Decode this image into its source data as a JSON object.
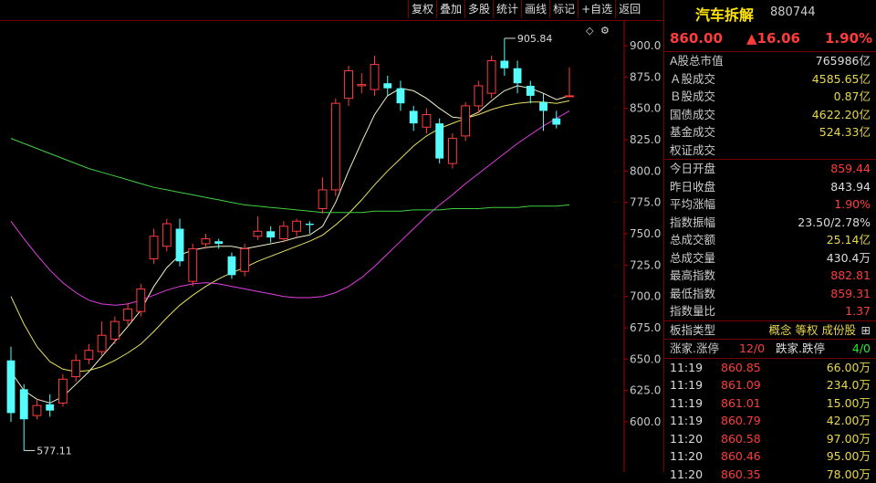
{
  "toolbar": {
    "items": [
      "复权",
      "叠加",
      "多股",
      "统计",
      "画线",
      "标记",
      "+自选",
      "返回"
    ]
  },
  "chart_icons": {
    "diamond": "◇",
    "settings": "⚙"
  },
  "chart_data": {
    "type": "candlestick",
    "yticks": [
      "900.0",
      "875.0",
      "850.0",
      "825.0",
      "800.0",
      "775.0",
      "750.0",
      "725.0",
      "700.0",
      "675.0",
      "650.0",
      "625.0",
      "600.0"
    ],
    "ylim": [
      580,
      915
    ],
    "annotations": {
      "high": "905.84",
      "low": "577.11"
    },
    "candles": [
      {
        "o": 649,
        "c": 607,
        "h": 660,
        "l": 600
      },
      {
        "o": 626,
        "c": 602,
        "h": 630,
        "l": 577
      },
      {
        "o": 605,
        "c": 613,
        "h": 618,
        "l": 602
      },
      {
        "o": 614,
        "c": 609,
        "h": 622,
        "l": 604
      },
      {
        "o": 615,
        "c": 634,
        "h": 638,
        "l": 612
      },
      {
        "o": 636,
        "c": 649,
        "h": 654,
        "l": 632
      },
      {
        "o": 650,
        "c": 657,
        "h": 662,
        "l": 646
      },
      {
        "o": 656,
        "c": 669,
        "h": 680,
        "l": 653
      },
      {
        "o": 666,
        "c": 680,
        "h": 684,
        "l": 662
      },
      {
        "o": 681,
        "c": 690,
        "h": 695,
        "l": 677
      },
      {
        "o": 688,
        "c": 706,
        "h": 710,
        "l": 684
      },
      {
        "o": 730,
        "c": 748,
        "h": 754,
        "l": 726
      },
      {
        "o": 740,
        "c": 758,
        "h": 762,
        "l": 736
      },
      {
        "o": 754,
        "c": 728,
        "h": 762,
        "l": 724
      },
      {
        "o": 712,
        "c": 738,
        "h": 742,
        "l": 708
      },
      {
        "o": 742,
        "c": 746,
        "h": 750,
        "l": 738
      },
      {
        "o": 744,
        "c": 742,
        "h": 746,
        "l": 738
      },
      {
        "o": 732,
        "c": 717,
        "h": 735,
        "l": 714
      },
      {
        "o": 720,
        "c": 738,
        "h": 742,
        "l": 716
      },
      {
        "o": 748,
        "c": 752,
        "h": 764,
        "l": 745
      },
      {
        "o": 752,
        "c": 747,
        "h": 756,
        "l": 743
      },
      {
        "o": 746,
        "c": 756,
        "h": 760,
        "l": 743
      },
      {
        "o": 752,
        "c": 760,
        "h": 762,
        "l": 748
      },
      {
        "o": 758,
        "c": 757,
        "h": 760,
        "l": 750
      },
      {
        "o": 770,
        "c": 785,
        "h": 795,
        "l": 766
      },
      {
        "o": 785,
        "c": 854,
        "h": 858,
        "l": 780
      },
      {
        "o": 858,
        "c": 880,
        "h": 884,
        "l": 852
      },
      {
        "o": 868,
        "c": 869,
        "h": 878,
        "l": 862
      },
      {
        "o": 865,
        "c": 885,
        "h": 892,
        "l": 860
      },
      {
        "o": 870,
        "c": 866,
        "h": 876,
        "l": 860
      },
      {
        "o": 866,
        "c": 854,
        "h": 872,
        "l": 848
      },
      {
        "o": 848,
        "c": 838,
        "h": 852,
        "l": 832
      },
      {
        "o": 835,
        "c": 845,
        "h": 850,
        "l": 830
      },
      {
        "o": 838,
        "c": 810,
        "h": 842,
        "l": 806
      },
      {
        "o": 806,
        "c": 826,
        "h": 830,
        "l": 802
      },
      {
        "o": 828,
        "c": 852,
        "h": 855,
        "l": 824
      },
      {
        "o": 852,
        "c": 868,
        "h": 872,
        "l": 846
      },
      {
        "o": 862,
        "c": 888,
        "h": 892,
        "l": 858
      },
      {
        "o": 888,
        "c": 882,
        "h": 905.84,
        "l": 876
      },
      {
        "o": 882,
        "c": 870,
        "h": 888,
        "l": 862
      },
      {
        "o": 868,
        "c": 860,
        "h": 872,
        "l": 854
      },
      {
        "o": 855,
        "c": 848,
        "h": 862,
        "l": 832
      },
      {
        "o": 842,
        "c": 837,
        "h": 848,
        "l": 834
      },
      {
        "o": 859.44,
        "c": 860,
        "h": 882.81,
        "l": 859.31
      }
    ],
    "ma_fast": [
      640,
      625,
      618,
      615,
      620,
      630,
      640,
      652,
      664,
      676,
      689,
      708,
      723,
      733,
      737,
      739,
      740,
      740,
      738,
      740,
      742,
      744,
      747,
      749,
      756,
      775,
      800,
      823,
      845,
      860,
      866,
      864,
      858,
      850,
      843,
      842,
      847,
      856,
      864,
      868,
      866,
      862,
      857,
      860
    ],
    "ma_mid": [
      700,
      678,
      660,
      648,
      642,
      640,
      641,
      644,
      649,
      655,
      662,
      672,
      683,
      693,
      701,
      708,
      714,
      719,
      723,
      728,
      732,
      736,
      740,
      744,
      749,
      757,
      766,
      777,
      789,
      800,
      810,
      820,
      828,
      834,
      838,
      842,
      845,
      849,
      852,
      854,
      855,
      855,
      854,
      856
    ],
    "ma_slow": [
      760,
      746,
      733,
      721,
      711,
      703,
      697,
      694,
      693,
      694,
      697,
      701,
      705,
      708,
      710,
      711,
      710,
      708,
      706,
      704,
      702,
      700,
      699,
      699,
      700,
      703,
      708,
      715,
      724,
      734,
      744,
      754,
      764,
      773,
      781,
      790,
      798,
      806,
      814,
      822,
      829,
      836,
      842,
      848
    ],
    "ma_long": [
      826,
      822,
      818,
      814,
      810,
      806,
      802,
      799,
      796,
      793,
      790,
      787,
      785,
      783,
      781,
      779,
      777,
      775,
      773,
      772,
      771,
      770,
      769,
      768,
      767,
      767,
      767,
      767,
      768,
      768,
      768,
      769,
      769,
      769,
      770,
      770,
      770,
      771,
      771,
      771,
      772,
      772,
      772,
      773
    ]
  },
  "panel": {
    "title": "汽车拆解",
    "code": "880744",
    "price": "860.00",
    "change": "▲16.06",
    "pct": "1.90%",
    "market": [
      {
        "label": "A股总市值",
        "value": "765986亿",
        "cls": "white"
      },
      {
        "label": "Ａ股成交",
        "value": "4585.65亿",
        "cls": "yellow"
      },
      {
        "label": "Ｂ股成交",
        "value": "0.87亿",
        "cls": "yellow"
      },
      {
        "label": "国债成交",
        "value": "4622.20亿",
        "cls": "yellow"
      },
      {
        "label": "基金成交",
        "value": "524.33亿",
        "cls": "yellow"
      },
      {
        "label": "权证成交",
        "value": "",
        "cls": "yellow"
      }
    ],
    "stats": [
      {
        "label": "今日开盘",
        "value": "859.44",
        "cls": "red"
      },
      {
        "label": "昨日收盘",
        "value": "843.94",
        "cls": "white"
      },
      {
        "label": "平均涨幅",
        "value": "1.90%",
        "cls": "red"
      },
      {
        "label": "指数振幅",
        "value": "23.50/2.78%",
        "cls": "white"
      },
      {
        "label": "总成交额",
        "value": "25.14亿",
        "cls": "yellow"
      },
      {
        "label": "总成交量",
        "value": "430.4万",
        "cls": "white"
      },
      {
        "label": "最高指数",
        "value": "882.81",
        "cls": "red"
      },
      {
        "label": "最低指数",
        "value": "859.31",
        "cls": "red"
      },
      {
        "label": "指数量比",
        "value": "1.37",
        "cls": "red"
      }
    ],
    "type_label": "板指类型",
    "type_value": "概念 等权 成份股",
    "type_icon": "⊞",
    "rise_label": "涨家.涨停",
    "rise_value": "12/0",
    "fall_label": "跌家.跌停",
    "fall_value": "4/0",
    "ticks": [
      {
        "t": "11:19",
        "p": "860.85",
        "v": "66.00万"
      },
      {
        "t": "11:19",
        "p": "861.09",
        "v": "234.0万"
      },
      {
        "t": "11:19",
        "p": "861.01",
        "v": "15.00万"
      },
      {
        "t": "11:19",
        "p": "860.79",
        "v": "42.00万"
      },
      {
        "t": "11:20",
        "p": "860.58",
        "v": "97.00万"
      },
      {
        "t": "11:20",
        "p": "860.46",
        "v": "95.00万"
      },
      {
        "t": "11:20",
        "p": "860.35",
        "v": "78.00万"
      }
    ]
  }
}
